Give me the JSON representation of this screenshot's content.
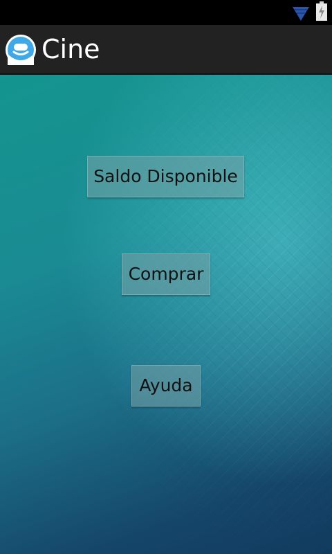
{
  "app": {
    "title": "Cine",
    "icon": "smiley-face-icon"
  },
  "status_bar": {
    "icons": [
      "wifi-icon",
      "battery-charging-icon"
    ]
  },
  "buttons": {
    "saldo": "Saldo Disponible",
    "comprar": "Comprar",
    "ayuda": "Ayuda"
  },
  "colors": {
    "action_bar": "#222222",
    "button_text": "#111111",
    "background_top": "#14958f",
    "background_bottom": "#113a5e"
  }
}
